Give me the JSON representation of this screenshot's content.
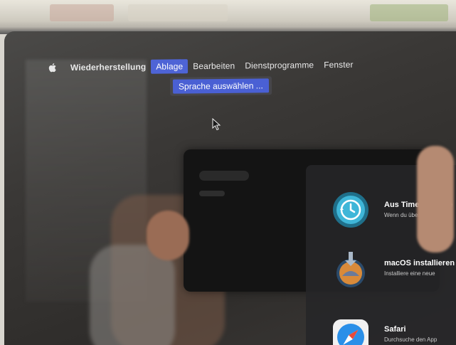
{
  "menubar": {
    "apple_icon": "apple-logo-icon",
    "app_name": "Wiederherstellung",
    "items": [
      "Ablage",
      "Bearbeiten",
      "Dienstprogramme",
      "Fenster"
    ],
    "active_item": "Ablage"
  },
  "dropdown": {
    "items": [
      "Sprache auswählen ..."
    ]
  },
  "recovery_options": [
    {
      "icon": "time-machine-icon",
      "title": "Aus Time Machine",
      "subtitle": "Wenn du über ein Ba"
    },
    {
      "icon": "macos-installer-icon",
      "title": "macOS installieren",
      "subtitle": "Installiere eine neue"
    },
    {
      "icon": "safari-compass-icon",
      "title": "Safari",
      "subtitle": "Durchsuche den App"
    }
  ],
  "colors": {
    "menu_highlight": "#4e64d6",
    "screen_bg": "#3a3836",
    "panel_bg": "#262628"
  }
}
